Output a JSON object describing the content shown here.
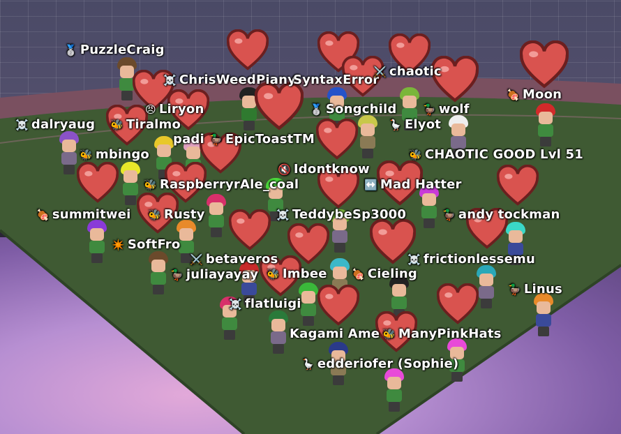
{
  "colors": {
    "wall": "#4a4a66",
    "ground": "#3f5a33",
    "track": "#6b4a55",
    "sky": "#b78fd2",
    "heart": "#d9534f"
  },
  "players": [
    {
      "name": "PuzzleCraig",
      "icon": "medal-icon",
      "glyph": "🥈"
    },
    {
      "name": "ChrisWeedPiany",
      "icon": "skull-icon",
      "glyph": "☠️"
    },
    {
      "name": "SyntaxError",
      "icon": "",
      "glyph": ""
    },
    {
      "name": "chaotic",
      "icon": "sword-icon",
      "glyph": "⚔️"
    },
    {
      "name": "Moon",
      "icon": "meat-icon",
      "glyph": "🍖"
    },
    {
      "name": "Liryon",
      "icon": "angry-face-icon",
      "glyph": "😠"
    },
    {
      "name": "Songchild",
      "icon": "medal-icon",
      "glyph": "🥈"
    },
    {
      "name": "wolf",
      "icon": "duck-icon",
      "glyph": "🦆"
    },
    {
      "name": "dalryaug",
      "icon": "skull-icon",
      "glyph": "☠️"
    },
    {
      "name": "Tiralmo",
      "icon": "bee-icon",
      "glyph": "🐝"
    },
    {
      "name": "Elyot",
      "icon": "goose-icon",
      "glyph": "🪿"
    },
    {
      "name": "padi",
      "icon": "",
      "glyph": ""
    },
    {
      "name": "EpicToastTM",
      "icon": "duck-icon",
      "glyph": "🦆"
    },
    {
      "name": "mbingo",
      "icon": "bee-icon",
      "glyph": "🐝"
    },
    {
      "name": "CHAOTIC GOOD Lvl 51",
      "icon": "bee-icon",
      "glyph": "🐝"
    },
    {
      "name": "Idontknow",
      "icon": "mute-icon",
      "glyph": "🔇"
    },
    {
      "name": "RaspberryrAle_coal",
      "icon": "bee-icon",
      "glyph": "🐝"
    },
    {
      "name": "Mad Hatter",
      "icon": "arrows-icon",
      "glyph": "↔️"
    },
    {
      "name": "summitwei",
      "icon": "meat-icon",
      "glyph": "🍖"
    },
    {
      "name": "Rusty",
      "icon": "bee-icon",
      "glyph": "🐝"
    },
    {
      "name": "TeddybeSp3000",
      "icon": "skull-icon",
      "glyph": "☠️"
    },
    {
      "name": "andy tockman",
      "icon": "duck-icon",
      "glyph": "🦆"
    },
    {
      "name": "SoftFro",
      "icon": "sparkle-icon",
      "glyph": "✴️"
    },
    {
      "name": "frictionlessemu",
      "icon": "skull-icon",
      "glyph": "☠️"
    },
    {
      "name": "betaveros",
      "icon": "sword-icon",
      "glyph": "⚔️"
    },
    {
      "name": "juliayayay",
      "icon": "duck-icon",
      "glyph": "🦆"
    },
    {
      "name": "Imbee",
      "icon": "bee-icon",
      "glyph": "🐝"
    },
    {
      "name": "Cieling",
      "icon": "meat-icon",
      "glyph": "🍖"
    },
    {
      "name": "Linus",
      "icon": "duck-icon",
      "glyph": "🦆"
    },
    {
      "name": "flatluigi",
      "icon": "skull-icon",
      "glyph": "☠️"
    },
    {
      "name": "Kagami Ame",
      "icon": "",
      "glyph": ""
    },
    {
      "name": "ManyPinkHats",
      "icon": "bee-icon",
      "glyph": "🐝"
    },
    {
      "name": "edderiofer (Sophie)",
      "icon": "goose-icon",
      "glyph": "🪿"
    }
  ]
}
